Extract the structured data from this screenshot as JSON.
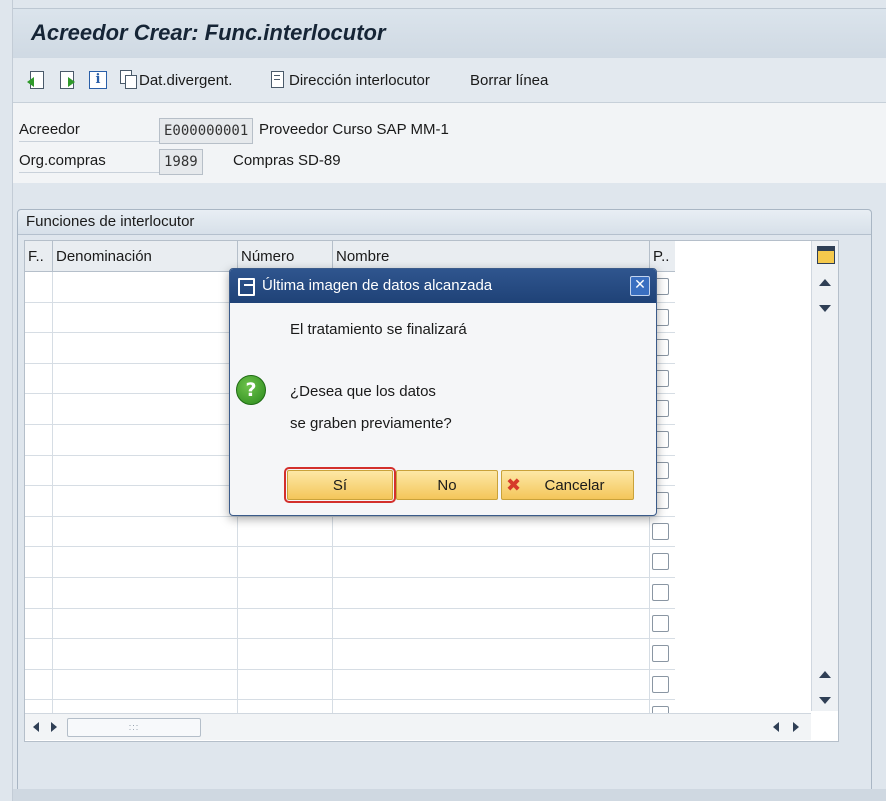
{
  "window": {
    "title": "Acreedor Crear: Func.interlocutor"
  },
  "toolbar": {
    "items": [
      {
        "label": "",
        "icon": "previous-screen-icon"
      },
      {
        "label": "",
        "icon": "next-screen-icon"
      },
      {
        "label": "",
        "icon": "info-icon"
      },
      {
        "label": "Dat.divergent.",
        "icon": "divergent-data-icon"
      },
      {
        "label": "Dirección interlocutor",
        "icon": "address-icon"
      },
      {
        "label": "Borrar línea",
        "icon": ""
      }
    ]
  },
  "header": {
    "vendor_label": "Acreedor",
    "vendor_value": "E000000001",
    "vendor_desc": "Proveedor Curso SAP MM-1",
    "purch_org_label": "Org.compras",
    "purch_org_value": "1989",
    "purch_org_desc": "Compras SD-89"
  },
  "group": {
    "title": "Funciones de interlocutor",
    "columns": [
      "F..",
      "Denominación",
      "Número",
      "Nombre",
      "P.."
    ],
    "row_count": 15
  },
  "modal": {
    "title": "Última imagen de datos alcanzada",
    "close_label": "✕",
    "message_line1": "El tratamiento se finalizará",
    "message_line2": "¿Desea que los datos",
    "message_line3": "se graben previamente?",
    "buttons": {
      "yes": "Sí",
      "no": "No",
      "cancel": "Cancelar"
    }
  },
  "colors": {
    "modal_title_bg": "#2f558e",
    "button_bg": "#f4c65a",
    "focus_outline": "#d3302c",
    "question_icon": "#2a8a1c"
  }
}
